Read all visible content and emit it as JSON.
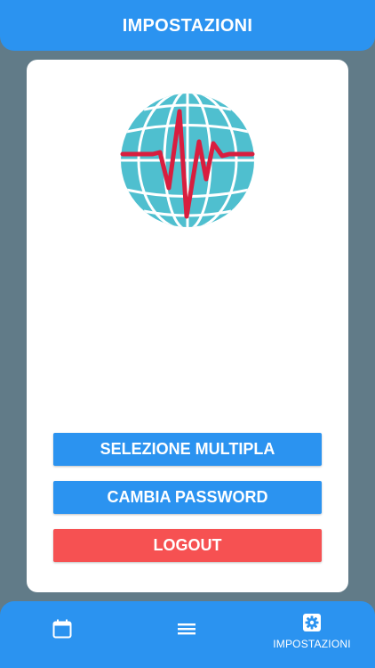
{
  "header": {
    "title": "IMPOSTAZIONI"
  },
  "logo": {
    "icon": "globe-heartbeat-icon",
    "globe_color": "#4fbfcf",
    "pulse_color": "#d81e3f"
  },
  "buttons": {
    "multi_select_label": "SELEZIONE MULTIPLA",
    "change_password_label": "CAMBIA PASSWORD",
    "logout_label": "LOGOUT"
  },
  "tabbar": {
    "tabs": [
      {
        "icon": "calendar-icon",
        "label": ""
      },
      {
        "icon": "list-icon",
        "label": ""
      },
      {
        "icon": "gear-icon",
        "label": "IMPOSTAZIONI",
        "active": true
      }
    ]
  },
  "colors": {
    "background": "#617b88",
    "primary": "#2b93f0",
    "danger": "#f65152",
    "card": "#ffffff"
  }
}
